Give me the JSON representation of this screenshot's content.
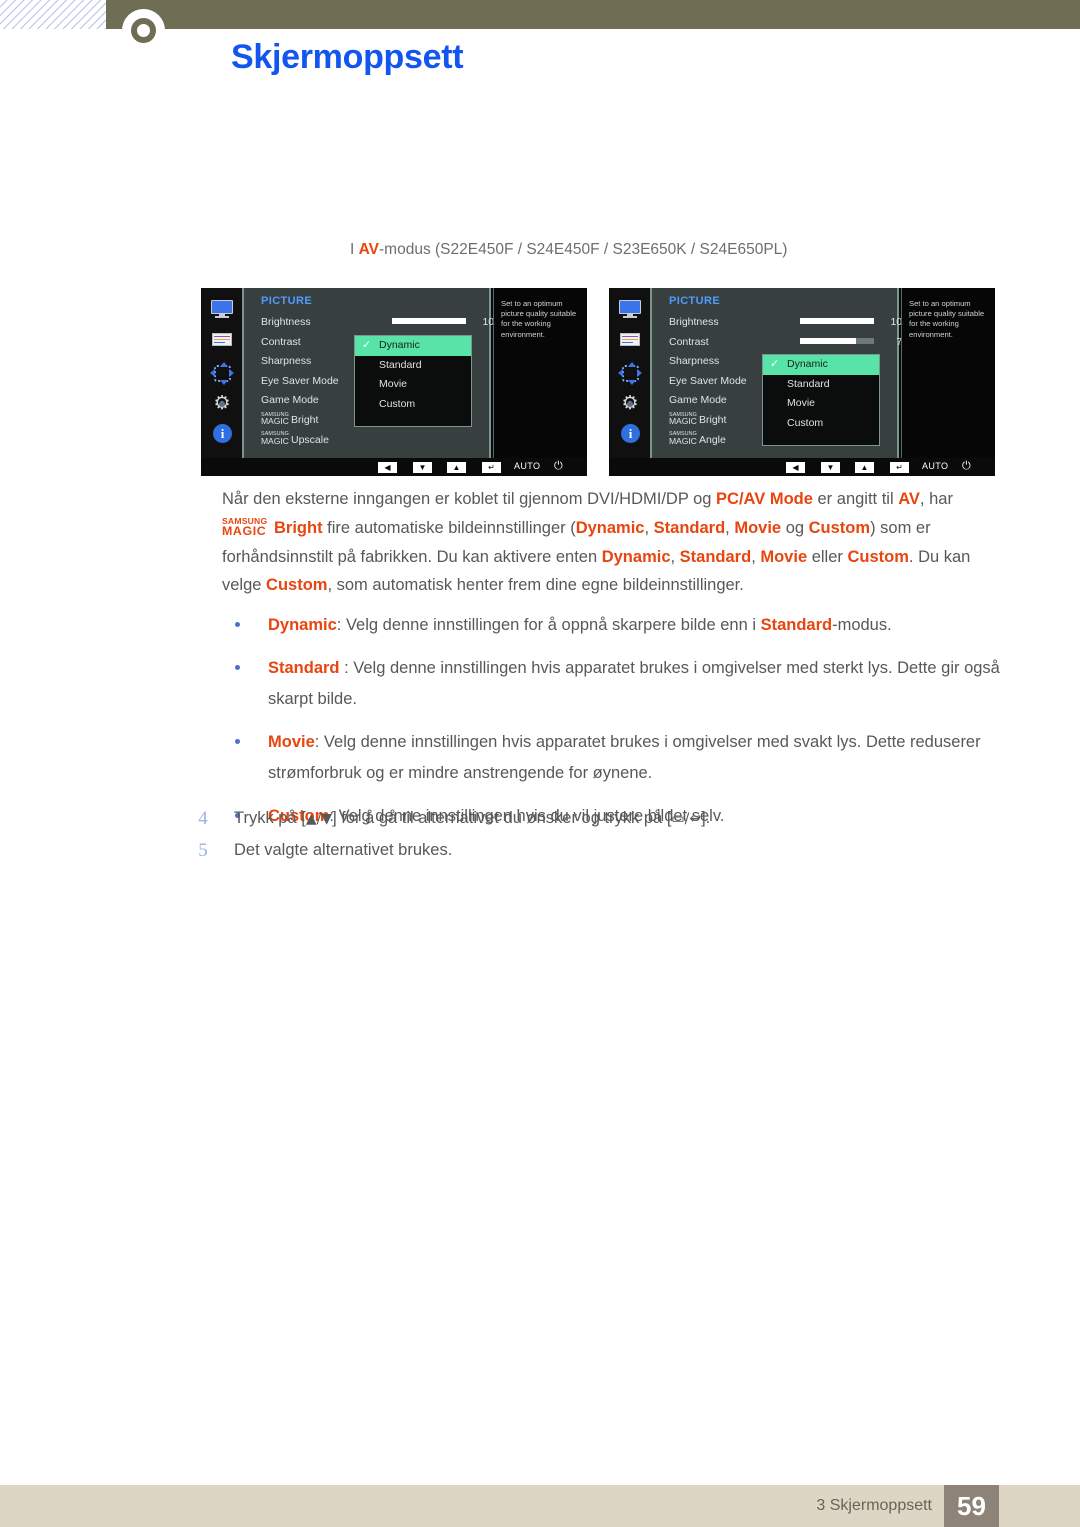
{
  "header": {
    "chapter_number": "3",
    "title": "Skjermoppsett"
  },
  "figure_caption": {
    "prefix": "I ",
    "highlight": "AV",
    "suffix": "-modus (S22E450F / S24E450F / S23E650K / S24E650PL)"
  },
  "osd_panels": [
    {
      "section_label": "PICTURE",
      "menu_items": [
        {
          "label": "Brightness"
        },
        {
          "label": "Contrast"
        },
        {
          "label": "Sharpness"
        },
        {
          "label": "Eye Saver Mode"
        },
        {
          "label": "Game Mode"
        },
        {
          "label": "Bright",
          "magic": true,
          "magic_top": "SAMSUNG",
          "magic_bottom": "MAGIC"
        },
        {
          "label": "Upscale",
          "magic": true,
          "magic_top": "SAMSUNG",
          "magic_bottom": "MAGIC"
        }
      ],
      "sliders": [
        {
          "name": "brightness",
          "value": "100",
          "fill_percent": 100
        }
      ],
      "dropdown": {
        "options": [
          "Dynamic",
          "Standard",
          "Movie",
          "Custom"
        ],
        "selected": "Dynamic"
      },
      "description": "Set to an optimum picture quality suitable for the working environment.",
      "footer_buttons": [
        "◀",
        "▼",
        "▲",
        "↵"
      ],
      "footer_auto": "AUTO",
      "footer_power": "⏻"
    },
    {
      "section_label": "PICTURE",
      "menu_items": [
        {
          "label": "Brightness"
        },
        {
          "label": "Contrast"
        },
        {
          "label": "Sharpness"
        },
        {
          "label": "Eye Saver Mode"
        },
        {
          "label": "Game Mode"
        },
        {
          "label": "Bright",
          "magic": true,
          "magic_top": "SAMSUNG",
          "magic_bottom": "MAGIC"
        },
        {
          "label": "Angle",
          "magic": true,
          "magic_top": "SAMSUNG",
          "magic_bottom": "MAGIC"
        }
      ],
      "sliders": [
        {
          "name": "brightness",
          "value": "100",
          "fill_percent": 100
        },
        {
          "name": "contrast",
          "value": "75",
          "fill_percent": 75
        }
      ],
      "dropdown": {
        "options": [
          "Dynamic",
          "Standard",
          "Movie",
          "Custom"
        ],
        "selected": "Dynamic"
      },
      "description": "Set to an optimum picture quality suitable for the working environment.",
      "footer_buttons": [
        "◀",
        "▼",
        "▲",
        "↵"
      ],
      "footer_auto": "AUTO",
      "footer_power": "⏻"
    }
  ],
  "body": {
    "p1_a": "Når den eksterne inngangen er koblet til gjennom DVI/HDMI/DP og ",
    "p1_b": "PC/AV Mode",
    "p1_c": " er angitt til ",
    "p1_d": "AV",
    "p1_e": ", har ",
    "magic_top": "SAMSUNG",
    "magic_bottom": "MAGIC",
    "p1_f": "Bright",
    "p1_g": " fire automatiske bildeinnstillinger (",
    "p1_h": "Dynamic",
    "p1_i": ", ",
    "p1_j": "Standard",
    "p1_k": ", ",
    "p1_l": "Movie",
    "p1_m": " og ",
    "p1_n": "Custom",
    "p1_o": ") som er forhåndsinnstilt på fabrikken. Du kan aktivere enten ",
    "p1_p": "Dynamic",
    "p1_q": ", ",
    "p1_r": "Standard",
    "p1_s": ", ",
    "p1_t": "Movie",
    "p1_u": " eller ",
    "p1_v": "Custom",
    "p1_w": ". Du kan velge ",
    "p1_x": "Custom",
    "p1_y": ", som automatisk henter frem dine egne bildeinnstillinger."
  },
  "bullets": [
    {
      "term": "Dynamic",
      "text_a": ": Velg denne innstillingen for å oppnå skarpere bilde enn i ",
      "term2": "Standard",
      "text_b": "-modus."
    },
    {
      "term": "Standard",
      "text_a": " : Velg denne innstillingen hvis apparatet brukes i omgivelser med sterkt lys. Dette gir også skarpt bilde.",
      "term2": "",
      "text_b": ""
    },
    {
      "term": "Movie",
      "text_a": ": Velg denne innstillingen hvis apparatet brukes i omgivelser med svakt lys. Dette reduserer strømforbruk og er mindre anstrengende for øynene.",
      "term2": "",
      "text_b": ""
    },
    {
      "term": "Custom",
      "text_a": ": Velg denne innstillingen hvis du vil justere bildet selv.",
      "term2": "",
      "text_b": ""
    }
  ],
  "steps": [
    {
      "number": "4",
      "text_a": "Trykk på [",
      "keys1": "▲/▼",
      "text_b": "] for å gå til alternativet du ønsker og trykk på [",
      "keys2": "▭/↩",
      "text_c": "]."
    },
    {
      "number": "5",
      "text_a": "Det valgte alternativet brukes.",
      "keys1": "",
      "text_b": "",
      "keys2": "",
      "text_c": ""
    }
  ],
  "footer": {
    "label": "3 Skjermoppsett",
    "page": "59"
  },
  "colors": {
    "header_olive": "#706d55",
    "title_blue": "#1256ef",
    "accent_orange": "#e8450f",
    "osd_highlight_green": "#58e3a8",
    "osd_panel_grey": "#37403f",
    "footer_beige": "#ddd6c5",
    "footer_page_box": "#8d8378"
  }
}
